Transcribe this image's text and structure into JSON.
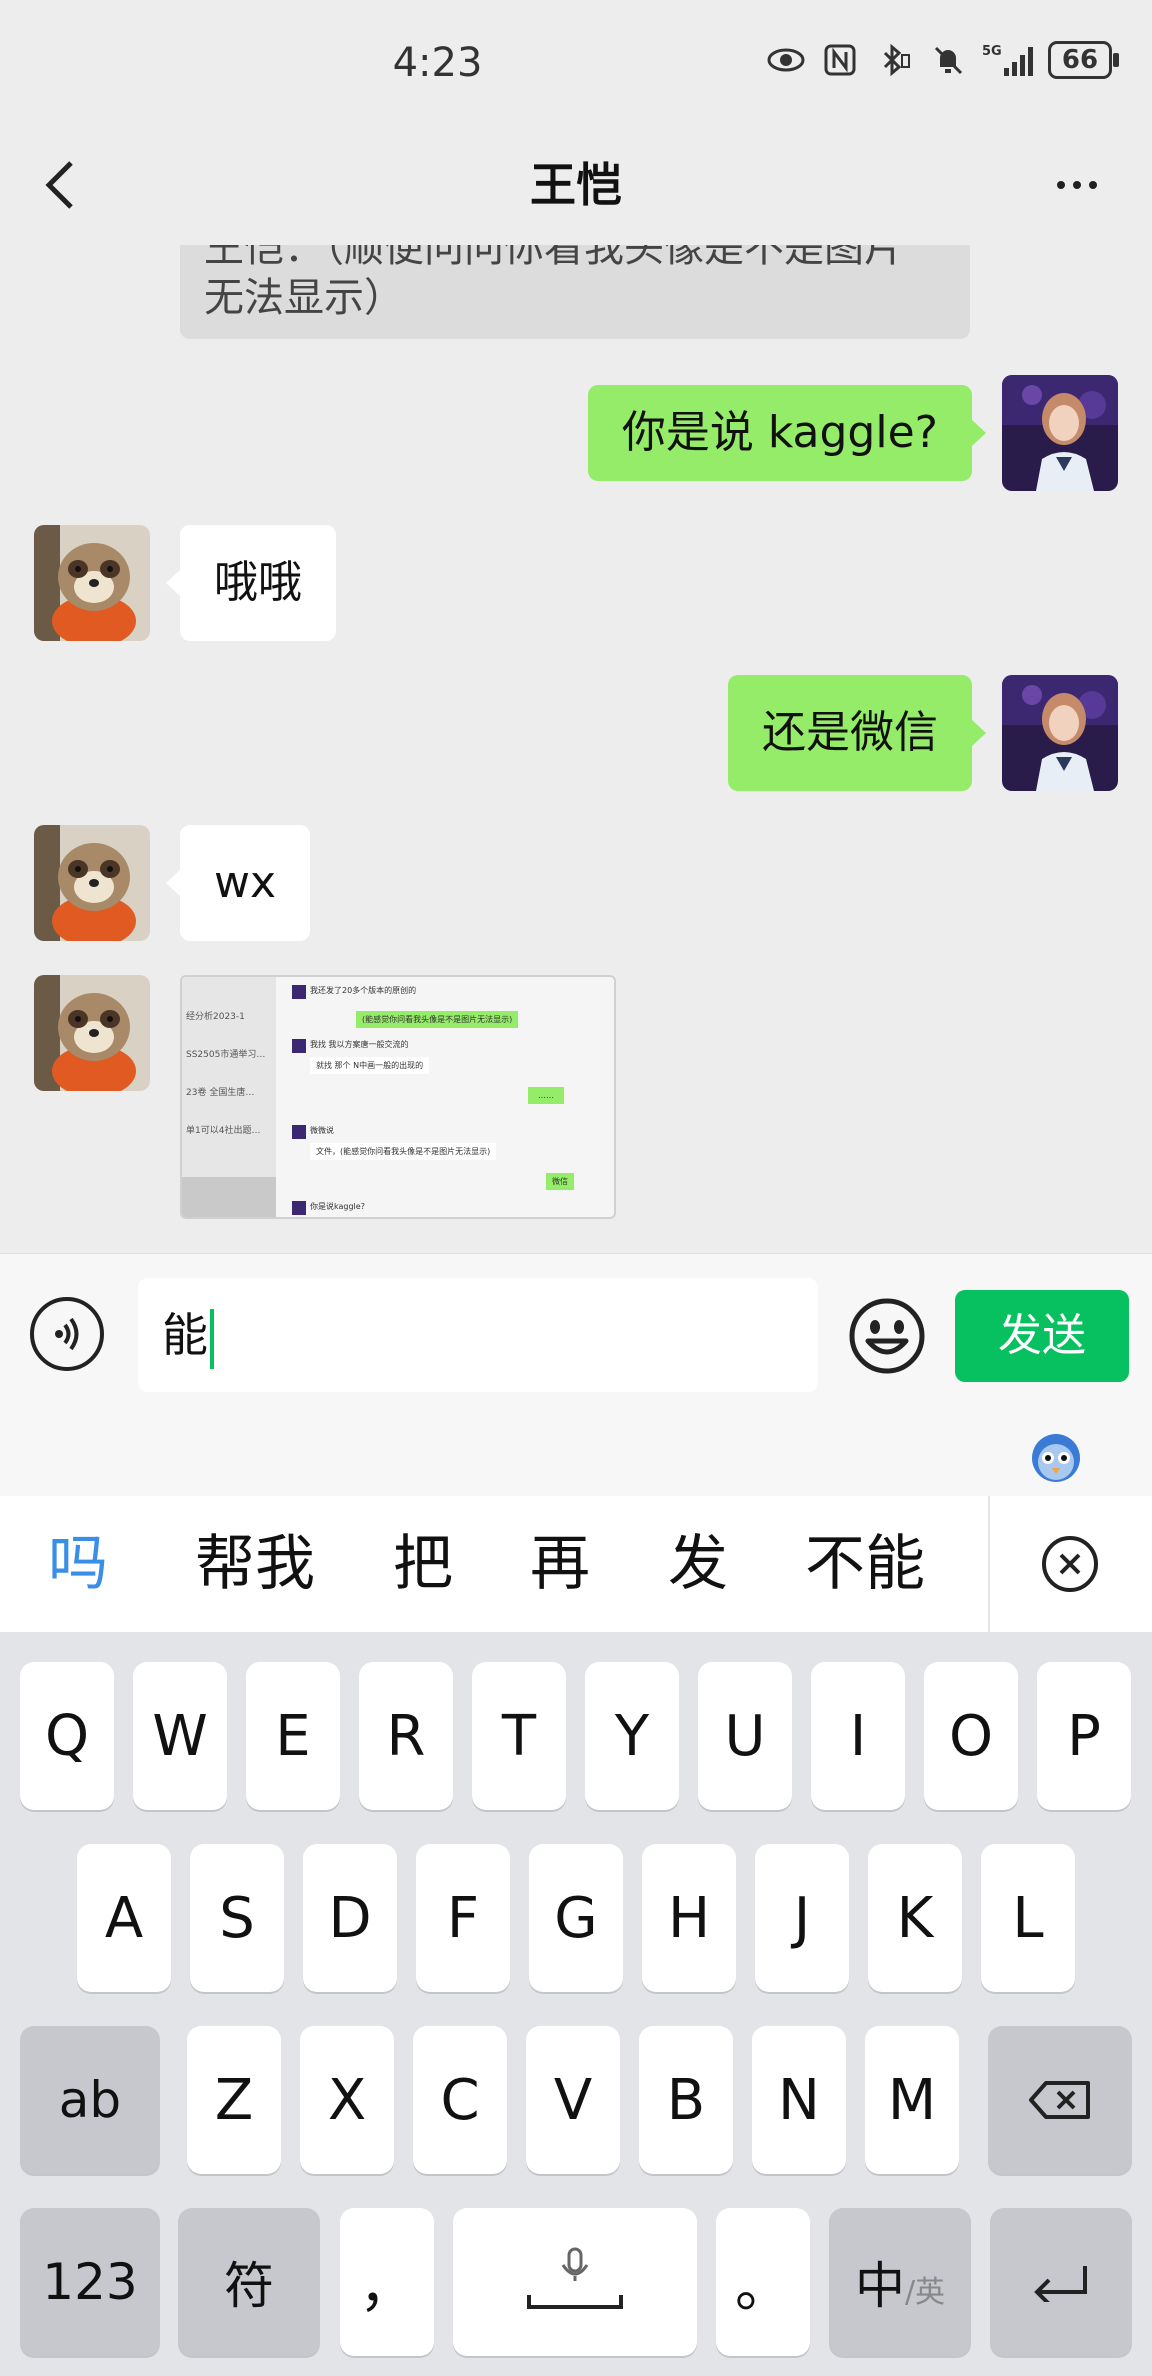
{
  "status_bar": {
    "time": "4:23",
    "network": "5G",
    "battery": "66",
    "icons": [
      "eye-icon",
      "nfc-icon",
      "bluetooth-icon",
      "mute-icon",
      "signal-icon",
      "battery-icon"
    ]
  },
  "header": {
    "title": "王恺",
    "back_icon": "chevron-left-icon",
    "more_icon": "more-dots-icon"
  },
  "chat": {
    "partial_message": {
      "line1": "王恺：（顺便问问你看我头像是不是图片",
      "line2": "无法显示）"
    },
    "messages": [
      {
        "side": "out",
        "text": "你是说 kaggle?"
      },
      {
        "side": "in",
        "text": "哦哦"
      },
      {
        "side": "out",
        "text": "还是微信"
      },
      {
        "side": "in",
        "text": "wx"
      },
      {
        "side": "in",
        "type": "image",
        "text": "screenshot"
      }
    ],
    "screenshot_texts": {
      "left": [
        "经分析2023-1",
        "SS2505市通举习…",
        "23卷 全国生唐…",
        "单1可以4社出题…"
      ],
      "right": [
        "我还发了20多个版本的原创的",
        "(能感觉你问看我头像是不是图片无法显示)",
        "我找 我以方案唐一般交流的",
        "就找 那个 N中画一般的出现的",
        "……",
        "微微说",
        "文件，(能感觉你问看我头像是不是图片无法显示)",
        "微信",
        "你是说kaggle?"
      ]
    }
  },
  "input_bar": {
    "voice_icon": "voice-icon",
    "input_value": "能",
    "emoji_icon": "emoji-icon",
    "send_label": "发送"
  },
  "ime": {
    "mascot_icon": "ime-mascot-icon",
    "candidates": [
      "吗",
      "帮我",
      "把",
      "再",
      "发",
      "不能"
    ],
    "selected_candidate_color": "#3a8ee6",
    "clear_icon": "clear-x-icon"
  },
  "keyboard": {
    "row1": [
      "Q",
      "W",
      "E",
      "R",
      "T",
      "Y",
      "U",
      "I",
      "O",
      "P"
    ],
    "row2": [
      "A",
      "S",
      "D",
      "F",
      "G",
      "H",
      "J",
      "K",
      "L"
    ],
    "row3": [
      "Z",
      "X",
      "C",
      "V",
      "B",
      "N",
      "M"
    ],
    "shift_label": "ab",
    "backspace_icon": "backspace-icon",
    "num_label": "123",
    "symbol_label": "符",
    "comma_label": "，",
    "space_icon": "space-mic-icon",
    "period_label": "。",
    "lang_main": "中",
    "lang_sub": "/英",
    "enter_icon": "enter-icon"
  },
  "colors": {
    "bubble_out": "#95ec69",
    "bubble_in": "#ffffff",
    "send_button": "#07c160",
    "background": "#ededed"
  }
}
